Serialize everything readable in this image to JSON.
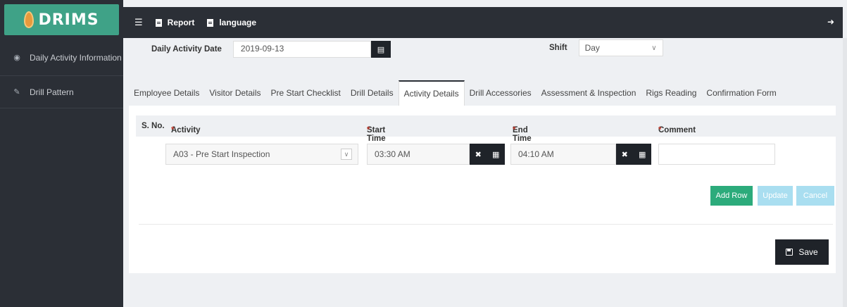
{
  "brand": {
    "logo_text": "DRIMS"
  },
  "sidebar": {
    "items": [
      {
        "label": "Daily Activity Information",
        "icon": "eye-icon"
      },
      {
        "label": "Drill Pattern",
        "icon": "pencil-icon"
      }
    ]
  },
  "topbar": {
    "report_label": "Report",
    "language_label": "language"
  },
  "form": {
    "date_label": "Daily Activity Date",
    "date_value": "2019-09-13",
    "shift_label": "Shift",
    "shift_value": "Day"
  },
  "tabs": [
    {
      "label": "Employee Details"
    },
    {
      "label": "Visitor Details"
    },
    {
      "label": "Pre Start Checklist"
    },
    {
      "label": "Drill Details"
    },
    {
      "label": "Activity Details",
      "active": true
    },
    {
      "label": "Drill Accessories"
    },
    {
      "label": "Assessment & Inspection"
    },
    {
      "label": "Rigs Reading"
    },
    {
      "label": "Confirmation Form"
    }
  ],
  "table": {
    "headers": {
      "sno": "S. No.",
      "activity": "Activity",
      "start": "Start Time",
      "end": "End Time",
      "comment": "Comment"
    },
    "row": {
      "activity": "A03 - Pre Start Inspection",
      "start_time": "03:30 AM",
      "end_time": "04:10 AM",
      "comment": ""
    }
  },
  "buttons": {
    "add_row": "Add Row",
    "update": "Update",
    "cancel": "Cancel",
    "save": "Save"
  },
  "colors": {
    "sidebar_bg": "#2b2f36",
    "accent_green": "#2cab7b",
    "disabled_blue": "#a9def0",
    "required_red": "#c0392b"
  }
}
